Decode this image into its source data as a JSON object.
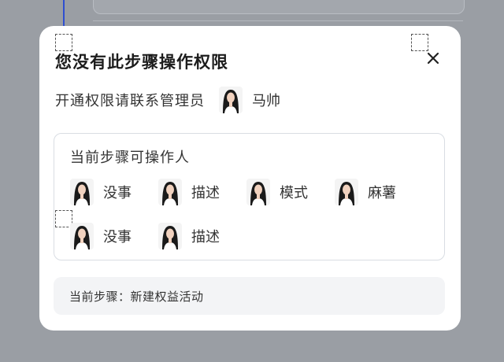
{
  "dialog": {
    "title": "您没有此步骤操作权限",
    "contact_text": "开通权限请联系管理员",
    "admin_name": "马帅",
    "close_icon": "close-icon"
  },
  "operators": {
    "title": "当前步骤可操作人",
    "people": [
      {
        "name": "没事"
      },
      {
        "name": "描述"
      },
      {
        "name": "模式"
      },
      {
        "name": "麻薯"
      },
      {
        "name": "没事"
      },
      {
        "name": "描述"
      }
    ]
  },
  "step": {
    "text": "当前步骤：新建权益活动"
  },
  "colors": {
    "overlay": "#8f9399",
    "modal_bg": "#ffffff",
    "border": "#d9dde3",
    "step_bg": "#f3f4f6",
    "text": "#333333",
    "accent": "#2f4fd0"
  }
}
